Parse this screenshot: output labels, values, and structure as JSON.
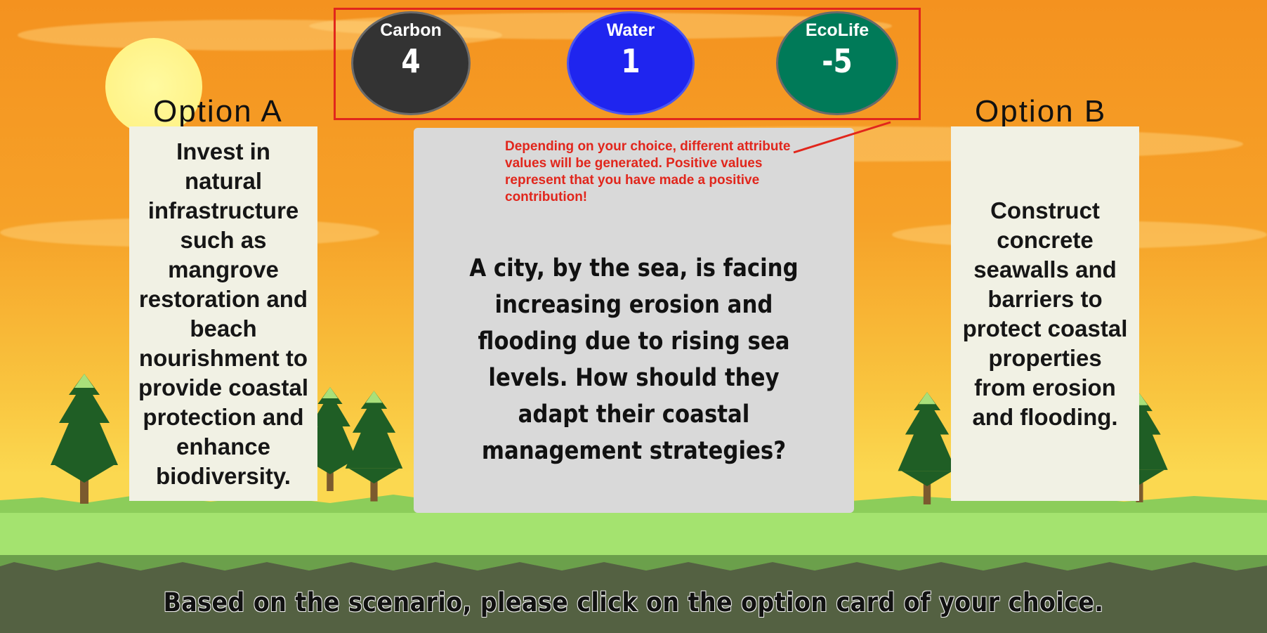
{
  "stats": [
    {
      "label": "Carbon",
      "value": "4",
      "color": "#333333"
    },
    {
      "label": "Water",
      "value": "1",
      "color": "#1f25ef"
    },
    {
      "label": "EcoLife",
      "value": "-5",
      "color": "#007a58"
    }
  ],
  "tutorial_hint": "Depending on your choice, different attribute values will be generated. Positive values represent that you have made a positive contribution!",
  "option_a": {
    "title": "Option A",
    "text": "Invest in natural infrastructure such as mangrove restoration and beach nourishment to provide coastal protection and enhance biodiversity."
  },
  "option_b": {
    "title": "Option B",
    "text": "Construct concrete seawalls and barriers to protect coastal properties from erosion and flooding."
  },
  "scenario": "A city, by the sea, is facing increasing erosion and flooding due to rising sea levels. How should they adapt their coastal management strategies?",
  "instruction": "Based on the scenario, please click on the option card of your choice.",
  "colors": {
    "highlight": "#e1261c",
    "card": "#f1f1e4",
    "scenario_card": "#d9d9d9"
  },
  "icons": [
    "sun-icon",
    "tree-icon"
  ]
}
